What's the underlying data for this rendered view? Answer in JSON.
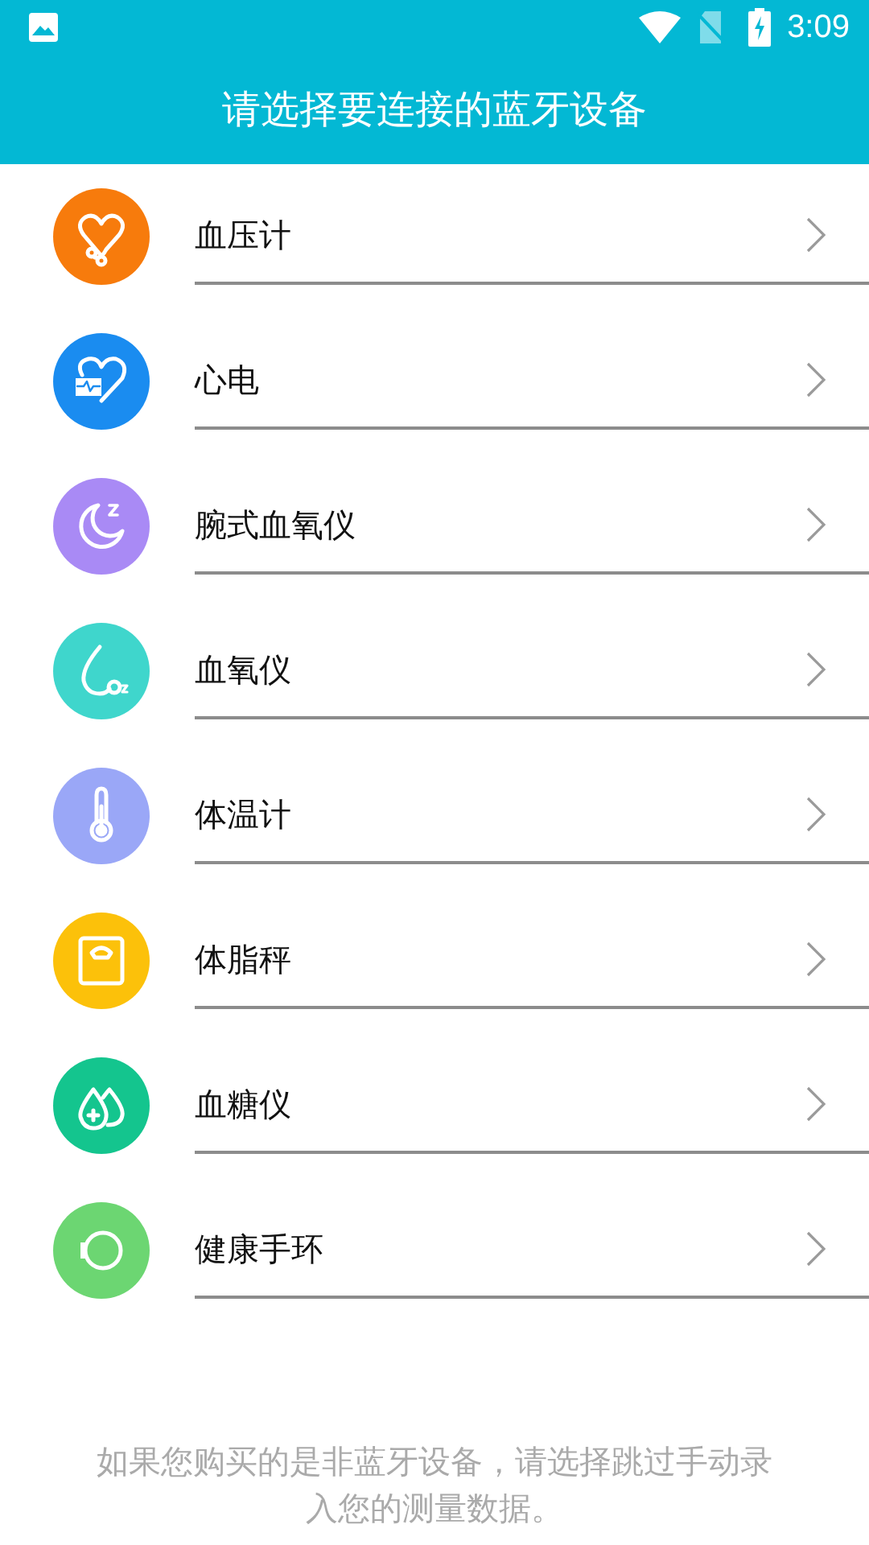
{
  "status_bar": {
    "time": "3:09"
  },
  "title": "请选择要连接的蓝牙设备",
  "devices": [
    {
      "label": "血压计",
      "kind": "stethoscope",
      "color": "#f77b0c"
    },
    {
      "label": "心电",
      "kind": "ecg",
      "color": "#1a8cf0"
    },
    {
      "label": "腕式血氧仪",
      "kind": "moon",
      "color": "#a98af5"
    },
    {
      "label": "血氧仪",
      "kind": "oxygen",
      "color": "#3fd6cc"
    },
    {
      "label": "体温计",
      "kind": "thermometer",
      "color": "#9aa7f7"
    },
    {
      "label": "体脂秤",
      "kind": "scale",
      "color": "#fcc10a"
    },
    {
      "label": "血糖仪",
      "kind": "drops",
      "color": "#14c58e"
    },
    {
      "label": "健康手环",
      "kind": "band",
      "color": "#6cd672"
    }
  ],
  "footer_note": "如果您购买的是非蓝牙设备，请选择跳过手动录入您的测量数据。"
}
